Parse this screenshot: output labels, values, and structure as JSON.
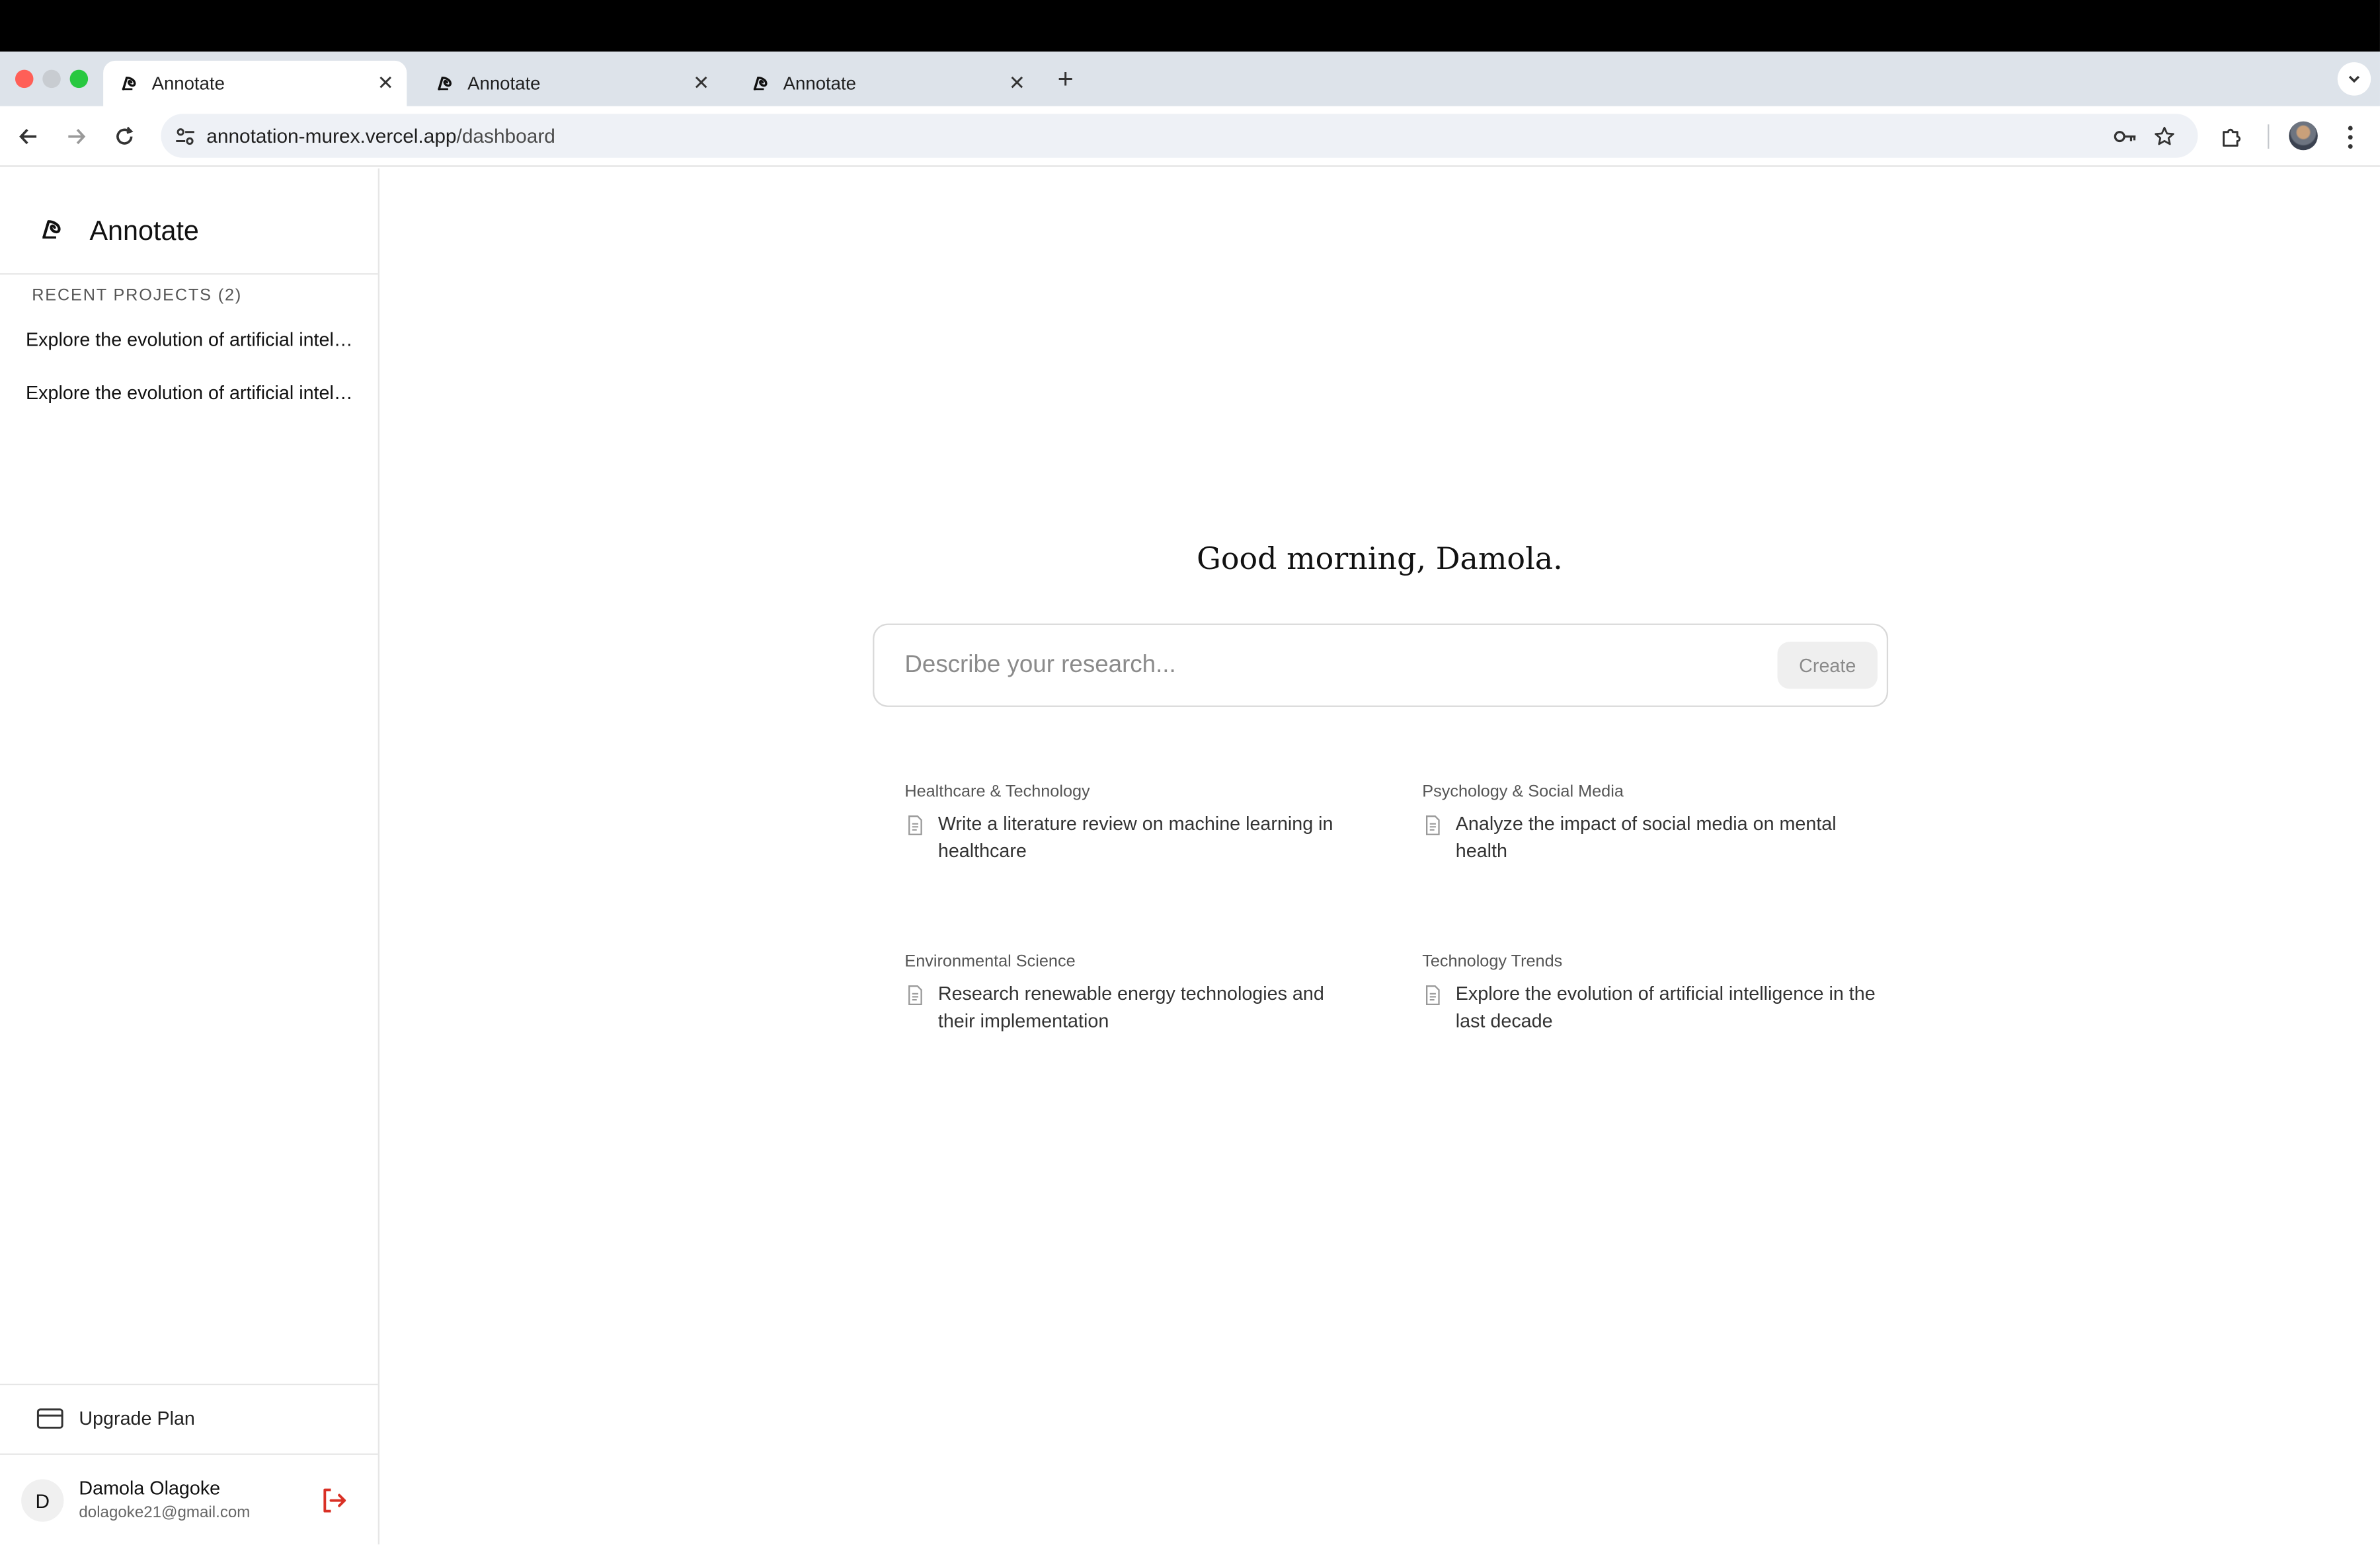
{
  "browser": {
    "tabs": [
      {
        "title": "Annotate",
        "active": true
      },
      {
        "title": "Annotate",
        "active": false
      },
      {
        "title": "Annotate",
        "active": false
      }
    ],
    "url_host": "annotation-murex.vercel.app",
    "url_path": "/dashboard"
  },
  "sidebar": {
    "brand": "Annotate",
    "recent_header": "RECENT PROJECTS (2)",
    "projects": [
      "Explore the evolution of artificial intelligence in the last decade",
      "Explore the evolution of artificial intelligence in the last decade"
    ],
    "upgrade_label": "Upgrade Plan",
    "user": {
      "initial": "D",
      "name": "Damola Olagoke",
      "email": "dolagoke21@gmail.com"
    }
  },
  "main": {
    "greeting": "Good morning, Damola.",
    "search_placeholder": "Describe your research...",
    "create_label": "Create",
    "suggestions": [
      {
        "category": "Healthcare & Technology",
        "text": "Write a literature review on machine learning in healthcare"
      },
      {
        "category": "Psychology & Social Media",
        "text": "Analyze the impact of social media on mental health"
      },
      {
        "category": "Environmental Science",
        "text": "Research renewable energy technologies and their implementation"
      },
      {
        "category": "Technology Trends",
        "text": "Explore the evolution of artificial intelligence in the last decade"
      }
    ]
  },
  "colors": {
    "tabstrip": "#dde3ea",
    "omnibox": "#eef1f6",
    "logout": "#d93025",
    "traffic_red": "#ff5f57",
    "traffic_green": "#28c840"
  }
}
